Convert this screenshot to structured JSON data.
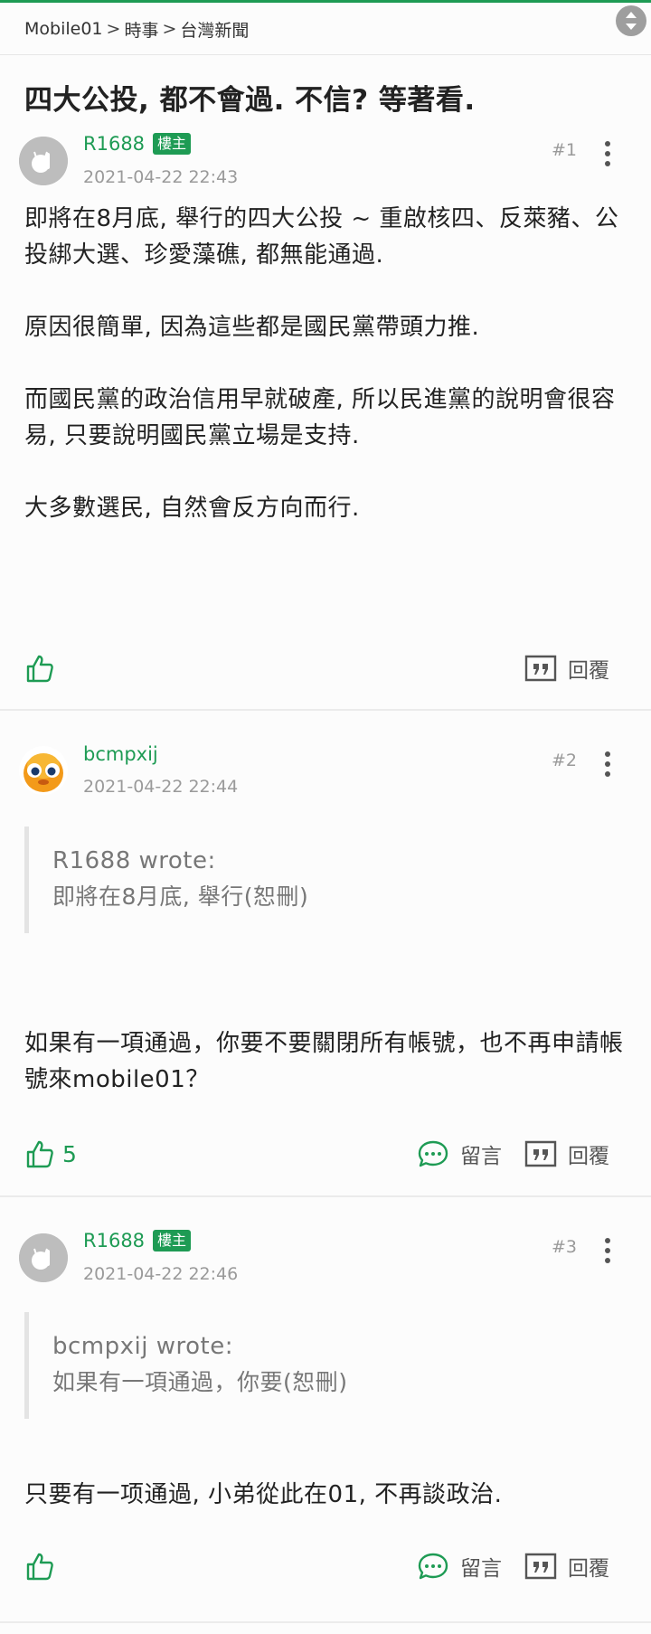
{
  "breadcrumb": {
    "items": [
      "Mobile01",
      "時事",
      "台灣新聞"
    ],
    "separator": ">"
  },
  "thread": {
    "title": "四大公投, 都不會過. 不信? 等著看."
  },
  "colors": {
    "accent": "#1e9b54",
    "muted": "#9a9a9a"
  },
  "posts": [
    {
      "username": "R1688",
      "badge": "樓主",
      "timestamp": "2021-04-22 22:43",
      "floor": "#1",
      "avatar": "default-avatar",
      "paragraphs": [
        "即將在8月底, 舉行的四大公投 ~ 重啟核四、反萊豬、公投綁大選、珍愛藻礁, 都無能通過.",
        "原因很簡單, 因為這些都是國民黨帶頭力推.",
        "而國民黨的政治信用早就破產, 所以民進黨的說明會很容易, 只要說明國民黨立場是支持.",
        "大多數選民, 自然會反方向而行."
      ],
      "like_count": "",
      "reply_label": "回覆"
    },
    {
      "username": "bcmpxij",
      "timestamp": "2021-04-22 22:44",
      "floor": "#2",
      "avatar": "cartoon-avatar",
      "quote": {
        "head": "R1688 wrote:",
        "body": "即將在8月底, 舉行(恕刪)"
      },
      "paragraphs": [
        "如果有一項通過，你要不要關閉所有帳號，也不再申請帳號來mobile01？"
      ],
      "like_count": "5",
      "comment_label": "留言",
      "reply_label": "回覆"
    },
    {
      "username": "R1688",
      "badge": "樓主",
      "timestamp": "2021-04-22 22:46",
      "floor": "#3",
      "avatar": "default-avatar",
      "quote": {
        "head": "bcmpxij wrote:",
        "body": "如果有一項通過，你要(恕刪)"
      },
      "paragraphs": [
        "只要有一项通過, 小弟從此在01, 不再談政治."
      ],
      "like_count": "",
      "comment_label": "留言",
      "reply_label": "回覆"
    }
  ]
}
